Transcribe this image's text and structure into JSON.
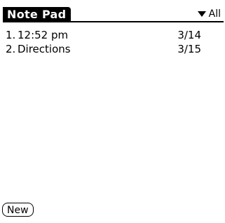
{
  "app": {
    "title": "Note Pad"
  },
  "category": {
    "selected": "All",
    "icon": "triangle-down-icon"
  },
  "notes": [
    {
      "number": "1.",
      "title": "12:52 pm",
      "date": "3/14"
    },
    {
      "number": "2.",
      "title": "Directions",
      "date": "3/15"
    }
  ],
  "buttons": {
    "new_label": "New"
  }
}
